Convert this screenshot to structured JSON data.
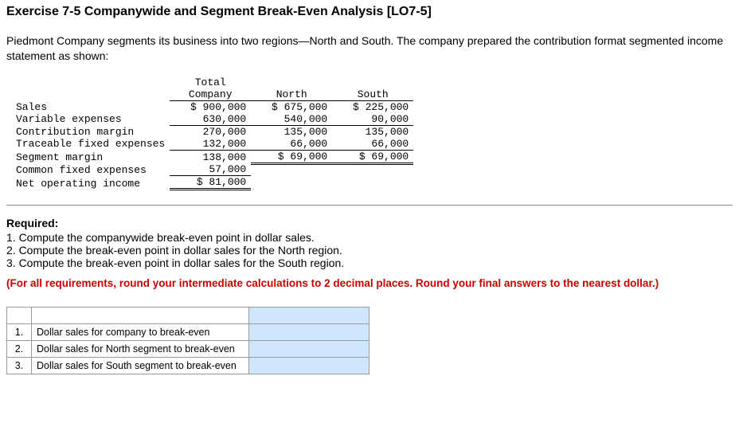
{
  "title": "Exercise 7-5 Companywide and Segment Break-Even Analysis [LO7-5]",
  "intro": "Piedmont Company segments its business into two regions—North and South. The company prepared the contribution format segmented income statement as shown:",
  "table": {
    "cols": {
      "c1": "Total Company",
      "c1a": "Total",
      "c1b": "Company",
      "c2": "North",
      "c3": "South"
    },
    "rows": {
      "sales": {
        "label": "Sales",
        "total": "$ 900,000",
        "north": "$ 675,000",
        "south": "$ 225,000"
      },
      "varexp": {
        "label": "Variable expenses",
        "total": "630,000",
        "north": "540,000",
        "south": "90,000"
      },
      "cm": {
        "label": "Contribution margin",
        "total": "270,000",
        "north": "135,000",
        "south": "135,000"
      },
      "tfe": {
        "label": "Traceable fixed expenses",
        "total": "132,000",
        "north": "66,000",
        "south": "66,000"
      },
      "segm": {
        "label": "Segment margin",
        "total": "138,000",
        "north": "$  69,000",
        "south": "$  69,000"
      },
      "cfe": {
        "label": "Common fixed expenses",
        "total": "57,000",
        "north": "",
        "south": ""
      },
      "noi": {
        "label": "Net operating income",
        "total": "$  81,000",
        "north": "",
        "south": ""
      }
    }
  },
  "required": {
    "head": "Required:",
    "r1": "1. Compute the companywide break-even point in dollar sales.",
    "r2": "2. Compute the break-even point in dollar sales for the North region.",
    "r3": "3. Compute the break-even point in dollar sales for the South region."
  },
  "note": "(For all requirements, round your intermediate calculations to 2 decimal places. Round your final answers to the nearest dollar.)",
  "answers": {
    "r1": {
      "n": "1.",
      "label": "Dollar sales for company to break-even",
      "value": ""
    },
    "r2": {
      "n": "2.",
      "label": "Dollar sales for North segment to break-even",
      "value": ""
    },
    "r3": {
      "n": "3.",
      "label": "Dollar sales for South segment to break-even",
      "value": ""
    }
  }
}
